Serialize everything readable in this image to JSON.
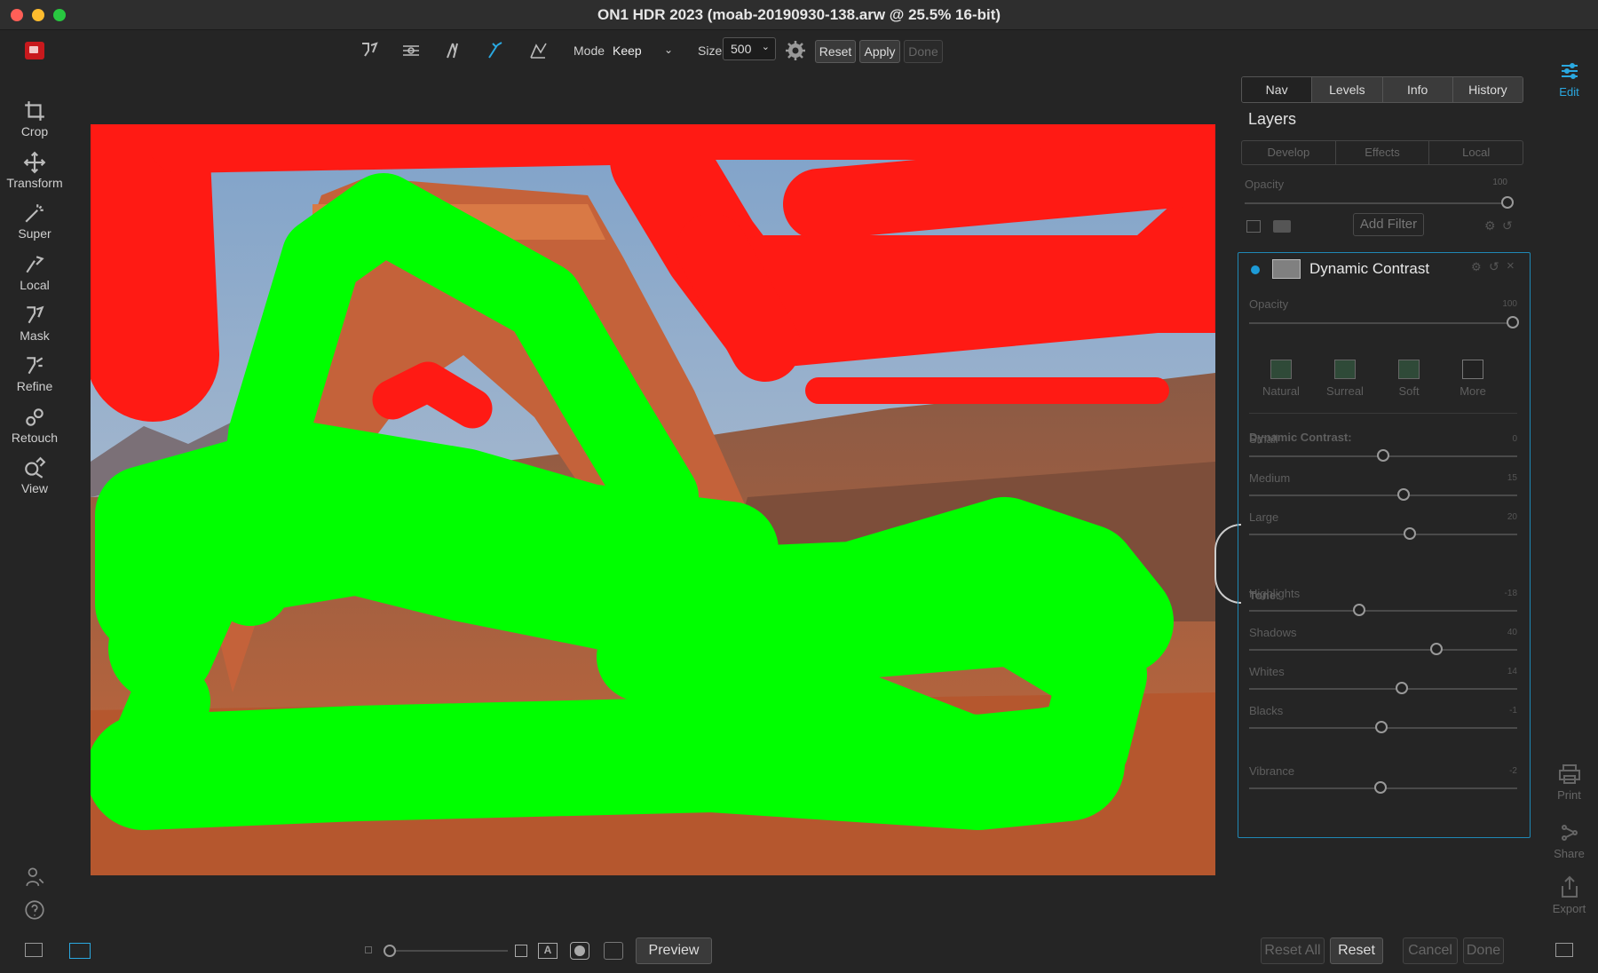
{
  "window": {
    "title": "ON1 HDR 2023 (moab-20190930-138.arw @ 25.5% 16-bit)"
  },
  "toolbar": {
    "mode_label": "Mode",
    "mode_value": "Keep",
    "size_label": "Size",
    "size_value": "500",
    "reset_label": "Reset",
    "apply_label": "Apply",
    "done_label": "Done"
  },
  "tools": [
    {
      "label": "Crop",
      "icon": "crop-icon"
    },
    {
      "label": "Transform",
      "icon": "move-icon"
    },
    {
      "label": "Super",
      "icon": "magic-brush-icon"
    },
    {
      "label": "Local",
      "icon": "local-brush-icon"
    },
    {
      "label": "Mask",
      "icon": "mask-brush-icon"
    },
    {
      "label": "Refine",
      "icon": "refine-brush-icon"
    },
    {
      "label": "Retouch",
      "icon": "retouch-icon"
    },
    {
      "label": "View",
      "icon": "zoom-icon"
    }
  ],
  "panel": {
    "tabs": [
      "Nav",
      "Levels",
      "Info",
      "History"
    ],
    "layers_title": "Layers",
    "subtabs": [
      "Develop",
      "Effects",
      "Local"
    ],
    "opacity_label": "Opacity",
    "opacity_value": "100",
    "add_filter": "Add Filter",
    "filter": {
      "name": "Dynamic Contrast",
      "opacity_label": "Opacity",
      "opacity_value": "100",
      "presets": [
        "Natural",
        "Surreal",
        "Soft",
        "More"
      ],
      "dc_section": "Dynamic Contrast:",
      "tone_section": "Tone:",
      "sliders": [
        {
          "label": "Small",
          "value": "0",
          "pos": 0.5
        },
        {
          "label": "Medium",
          "value": "15",
          "pos": 0.575
        },
        {
          "label": "Large",
          "value": "20",
          "pos": 0.6
        },
        {
          "label": "Highlights",
          "value": "-18",
          "pos": 0.41
        },
        {
          "label": "Shadows",
          "value": "40",
          "pos": 0.7
        },
        {
          "label": "Whites",
          "value": "14",
          "pos": 0.57
        },
        {
          "label": "Blacks",
          "value": "-1",
          "pos": 0.495
        },
        {
          "label": "Vibrance",
          "value": "-2",
          "pos": 0.49
        }
      ]
    }
  },
  "right_rail": {
    "edit": "Edit",
    "print": "Print",
    "share": "Share",
    "export": "Export"
  },
  "bottom": {
    "preview": "Preview",
    "reset_all": "Reset All",
    "reset": "Reset",
    "cancel": "Cancel",
    "done": "Done"
  },
  "colors": {
    "accent": "#1f88b5",
    "mask_red": "#ff1a14",
    "mask_green": "#00ff00"
  }
}
